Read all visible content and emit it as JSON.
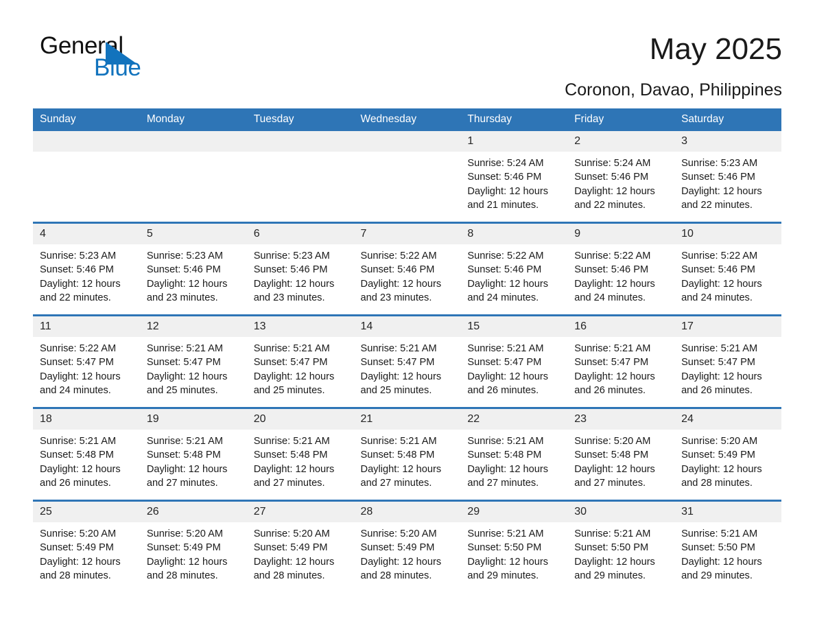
{
  "brand": {
    "name_part1": "General",
    "name_part2": "Blue",
    "accent_color": "#1273bd"
  },
  "header": {
    "month_title": "May 2025",
    "location": "Coronon, Davao, Philippines"
  },
  "theme": {
    "header_blue": "#2e75b6",
    "row_divider_blue": "#2e75b6",
    "daynum_band_gray": "#f0f0f0"
  },
  "calendar": {
    "weekday_headers": [
      "Sunday",
      "Monday",
      "Tuesday",
      "Wednesday",
      "Thursday",
      "Friday",
      "Saturday"
    ],
    "weeks": [
      [
        {
          "day": "",
          "sunrise": "",
          "sunset": "",
          "daylight": "",
          "empty": true
        },
        {
          "day": "",
          "sunrise": "",
          "sunset": "",
          "daylight": "",
          "empty": true
        },
        {
          "day": "",
          "sunrise": "",
          "sunset": "",
          "daylight": "",
          "empty": true
        },
        {
          "day": "",
          "sunrise": "",
          "sunset": "",
          "daylight": "",
          "empty": true
        },
        {
          "day": "1",
          "sunrise": "Sunrise: 5:24 AM",
          "sunset": "Sunset: 5:46 PM",
          "daylight": "Daylight: 12 hours and 21 minutes.",
          "empty": false
        },
        {
          "day": "2",
          "sunrise": "Sunrise: 5:24 AM",
          "sunset": "Sunset: 5:46 PM",
          "daylight": "Daylight: 12 hours and 22 minutes.",
          "empty": false
        },
        {
          "day": "3",
          "sunrise": "Sunrise: 5:23 AM",
          "sunset": "Sunset: 5:46 PM",
          "daylight": "Daylight: 12 hours and 22 minutes.",
          "empty": false
        }
      ],
      [
        {
          "day": "4",
          "sunrise": "Sunrise: 5:23 AM",
          "sunset": "Sunset: 5:46 PM",
          "daylight": "Daylight: 12 hours and 22 minutes.",
          "empty": false
        },
        {
          "day": "5",
          "sunrise": "Sunrise: 5:23 AM",
          "sunset": "Sunset: 5:46 PM",
          "daylight": "Daylight: 12 hours and 23 minutes.",
          "empty": false
        },
        {
          "day": "6",
          "sunrise": "Sunrise: 5:23 AM",
          "sunset": "Sunset: 5:46 PM",
          "daylight": "Daylight: 12 hours and 23 minutes.",
          "empty": false
        },
        {
          "day": "7",
          "sunrise": "Sunrise: 5:22 AM",
          "sunset": "Sunset: 5:46 PM",
          "daylight": "Daylight: 12 hours and 23 minutes.",
          "empty": false
        },
        {
          "day": "8",
          "sunrise": "Sunrise: 5:22 AM",
          "sunset": "Sunset: 5:46 PM",
          "daylight": "Daylight: 12 hours and 24 minutes.",
          "empty": false
        },
        {
          "day": "9",
          "sunrise": "Sunrise: 5:22 AM",
          "sunset": "Sunset: 5:46 PM",
          "daylight": "Daylight: 12 hours and 24 minutes.",
          "empty": false
        },
        {
          "day": "10",
          "sunrise": "Sunrise: 5:22 AM",
          "sunset": "Sunset: 5:46 PM",
          "daylight": "Daylight: 12 hours and 24 minutes.",
          "empty": false
        }
      ],
      [
        {
          "day": "11",
          "sunrise": "Sunrise: 5:22 AM",
          "sunset": "Sunset: 5:47 PM",
          "daylight": "Daylight: 12 hours and 24 minutes.",
          "empty": false
        },
        {
          "day": "12",
          "sunrise": "Sunrise: 5:21 AM",
          "sunset": "Sunset: 5:47 PM",
          "daylight": "Daylight: 12 hours and 25 minutes.",
          "empty": false
        },
        {
          "day": "13",
          "sunrise": "Sunrise: 5:21 AM",
          "sunset": "Sunset: 5:47 PM",
          "daylight": "Daylight: 12 hours and 25 minutes.",
          "empty": false
        },
        {
          "day": "14",
          "sunrise": "Sunrise: 5:21 AM",
          "sunset": "Sunset: 5:47 PM",
          "daylight": "Daylight: 12 hours and 25 minutes.",
          "empty": false
        },
        {
          "day": "15",
          "sunrise": "Sunrise: 5:21 AM",
          "sunset": "Sunset: 5:47 PM",
          "daylight": "Daylight: 12 hours and 26 minutes.",
          "empty": false
        },
        {
          "day": "16",
          "sunrise": "Sunrise: 5:21 AM",
          "sunset": "Sunset: 5:47 PM",
          "daylight": "Daylight: 12 hours and 26 minutes.",
          "empty": false
        },
        {
          "day": "17",
          "sunrise": "Sunrise: 5:21 AM",
          "sunset": "Sunset: 5:47 PM",
          "daylight": "Daylight: 12 hours and 26 minutes.",
          "empty": false
        }
      ],
      [
        {
          "day": "18",
          "sunrise": "Sunrise: 5:21 AM",
          "sunset": "Sunset: 5:48 PM",
          "daylight": "Daylight: 12 hours and 26 minutes.",
          "empty": false
        },
        {
          "day": "19",
          "sunrise": "Sunrise: 5:21 AM",
          "sunset": "Sunset: 5:48 PM",
          "daylight": "Daylight: 12 hours and 27 minutes.",
          "empty": false
        },
        {
          "day": "20",
          "sunrise": "Sunrise: 5:21 AM",
          "sunset": "Sunset: 5:48 PM",
          "daylight": "Daylight: 12 hours and 27 minutes.",
          "empty": false
        },
        {
          "day": "21",
          "sunrise": "Sunrise: 5:21 AM",
          "sunset": "Sunset: 5:48 PM",
          "daylight": "Daylight: 12 hours and 27 minutes.",
          "empty": false
        },
        {
          "day": "22",
          "sunrise": "Sunrise: 5:21 AM",
          "sunset": "Sunset: 5:48 PM",
          "daylight": "Daylight: 12 hours and 27 minutes.",
          "empty": false
        },
        {
          "day": "23",
          "sunrise": "Sunrise: 5:20 AM",
          "sunset": "Sunset: 5:48 PM",
          "daylight": "Daylight: 12 hours and 27 minutes.",
          "empty": false
        },
        {
          "day": "24",
          "sunrise": "Sunrise: 5:20 AM",
          "sunset": "Sunset: 5:49 PM",
          "daylight": "Daylight: 12 hours and 28 minutes.",
          "empty": false
        }
      ],
      [
        {
          "day": "25",
          "sunrise": "Sunrise: 5:20 AM",
          "sunset": "Sunset: 5:49 PM",
          "daylight": "Daylight: 12 hours and 28 minutes.",
          "empty": false
        },
        {
          "day": "26",
          "sunrise": "Sunrise: 5:20 AM",
          "sunset": "Sunset: 5:49 PM",
          "daylight": "Daylight: 12 hours and 28 minutes.",
          "empty": false
        },
        {
          "day": "27",
          "sunrise": "Sunrise: 5:20 AM",
          "sunset": "Sunset: 5:49 PM",
          "daylight": "Daylight: 12 hours and 28 minutes.",
          "empty": false
        },
        {
          "day": "28",
          "sunrise": "Sunrise: 5:20 AM",
          "sunset": "Sunset: 5:49 PM",
          "daylight": "Daylight: 12 hours and 28 minutes.",
          "empty": false
        },
        {
          "day": "29",
          "sunrise": "Sunrise: 5:21 AM",
          "sunset": "Sunset: 5:50 PM",
          "daylight": "Daylight: 12 hours and 29 minutes.",
          "empty": false
        },
        {
          "day": "30",
          "sunrise": "Sunrise: 5:21 AM",
          "sunset": "Sunset: 5:50 PM",
          "daylight": "Daylight: 12 hours and 29 minutes.",
          "empty": false
        },
        {
          "day": "31",
          "sunrise": "Sunrise: 5:21 AM",
          "sunset": "Sunset: 5:50 PM",
          "daylight": "Daylight: 12 hours and 29 minutes.",
          "empty": false
        }
      ]
    ]
  }
}
